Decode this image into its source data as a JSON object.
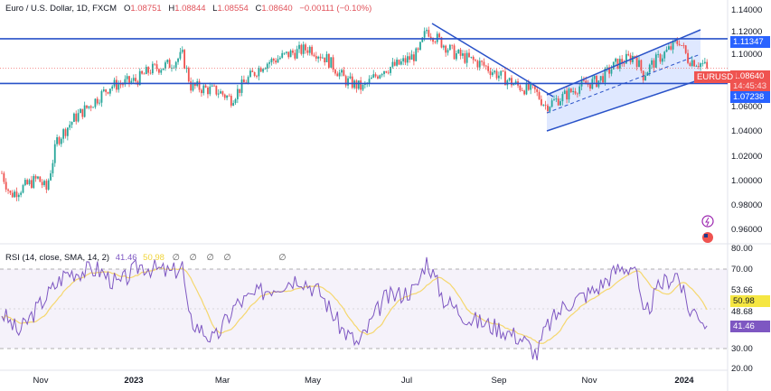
{
  "header": {
    "title": "Euro / U.S. Dollar, 1D, FXCM",
    "open_label": "O",
    "open": "1.08751",
    "high_label": "H",
    "high": "1.08844",
    "low_label": "L",
    "low": "1.08554",
    "close_label": "C",
    "close": "1.08640",
    "change": "−0.00111 (−0.10%)"
  },
  "rsi": {
    "title": "RSI (14, close, SMA, 14, 2)",
    "value": "41.46",
    "sma": "50.98",
    "na": [
      "∅",
      "∅",
      "∅",
      "∅",
      "∅"
    ],
    "axis": [
      "80.00",
      "70.00",
      "53.66",
      "48.68",
      "30.00",
      "20.00"
    ],
    "value_tag": "41.46",
    "sma_tag": "50.98"
  },
  "price_axis": [
    "1.14000",
    "1.12000",
    "1.10000",
    "1.06000",
    "1.04000",
    "1.02000",
    "1.00000",
    "0.98000",
    "0.96000"
  ],
  "tags": {
    "resistance": "1.11347",
    "support": "1.07238",
    "last_price": "1.08640",
    "countdown": "14:45:43",
    "symbol": "EURUSD"
  },
  "x_axis": [
    "Nov",
    "2023",
    "Mar",
    "May",
    "Jul",
    "Sep",
    "Nov",
    "2024"
  ],
  "colors": {
    "up": "#26a69a",
    "down": "#ef5350",
    "level": "#2962ff",
    "rsi": "#7e57c2",
    "sma": "#f5d76e"
  },
  "chart_data": {
    "type": "candlestick",
    "symbol": "EURUSD",
    "timeframe": "1D",
    "ylim": [
      0.95,
      1.145
    ],
    "levels": [
      1.11347,
      1.07238
    ],
    "close_path": [
      [
        0,
        0.99
      ],
      [
        4,
        0.97
      ],
      [
        17,
        0.985
      ],
      [
        21,
        0.975
      ],
      [
        26,
        1.02
      ],
      [
        34,
        1.04
      ],
      [
        43,
        1.055
      ],
      [
        51,
        1.07
      ],
      [
        63,
        1.075
      ],
      [
        70,
        1.085
      ],
      [
        79,
        1.09
      ],
      [
        85,
        1.098
      ],
      [
        89,
        1.07
      ],
      [
        102,
        1.065
      ],
      [
        108,
        1.058
      ],
      [
        115,
        1.075
      ],
      [
        123,
        1.09
      ],
      [
        136,
        1.1
      ],
      [
        145,
        1.105
      ],
      [
        153,
        1.095
      ],
      [
        162,
        1.075
      ],
      [
        170,
        1.068
      ],
      [
        179,
        1.085
      ],
      [
        187,
        1.09
      ],
      [
        196,
        1.1
      ],
      [
        200,
        1.122
      ],
      [
        204,
        1.115
      ],
      [
        213,
        1.1
      ],
      [
        226,
        1.09
      ],
      [
        234,
        1.08
      ],
      [
        243,
        1.07
      ],
      [
        251,
        1.065
      ],
      [
        256,
        1.052
      ],
      [
        264,
        1.06
      ],
      [
        272,
        1.07
      ],
      [
        281,
        1.075
      ],
      [
        289,
        1.09
      ],
      [
        298,
        1.098
      ],
      [
        302,
        1.08
      ],
      [
        306,
        1.09
      ],
      [
        315,
        1.105
      ],
      [
        319,
        1.112
      ],
      [
        323,
        1.095
      ],
      [
        330,
        1.09
      ],
      [
        332,
        1.0864
      ]
    ],
    "rsi_path": [
      [
        0,
        48
      ],
      [
        8,
        38
      ],
      [
        20,
        55
      ],
      [
        30,
        68
      ],
      [
        45,
        70
      ],
      [
        55,
        62
      ],
      [
        65,
        72
      ],
      [
        80,
        68
      ],
      [
        85,
        72
      ],
      [
        88,
        45
      ],
      [
        100,
        34
      ],
      [
        110,
        52
      ],
      [
        125,
        60
      ],
      [
        140,
        66
      ],
      [
        150,
        58
      ],
      [
        160,
        40
      ],
      [
        168,
        32
      ],
      [
        180,
        55
      ],
      [
        195,
        60
      ],
      [
        200,
        75
      ],
      [
        208,
        55
      ],
      [
        220,
        45
      ],
      [
        235,
        40
      ],
      [
        245,
        35
      ],
      [
        252,
        27
      ],
      [
        256,
        40
      ],
      [
        265,
        52
      ],
      [
        280,
        60
      ],
      [
        290,
        70
      ],
      [
        298,
        72
      ],
      [
        302,
        45
      ],
      [
        310,
        62
      ],
      [
        318,
        68
      ],
      [
        323,
        50
      ],
      [
        328,
        48
      ],
      [
        332,
        41.46
      ]
    ],
    "rsi_levels": [
      70,
      30
    ]
  }
}
